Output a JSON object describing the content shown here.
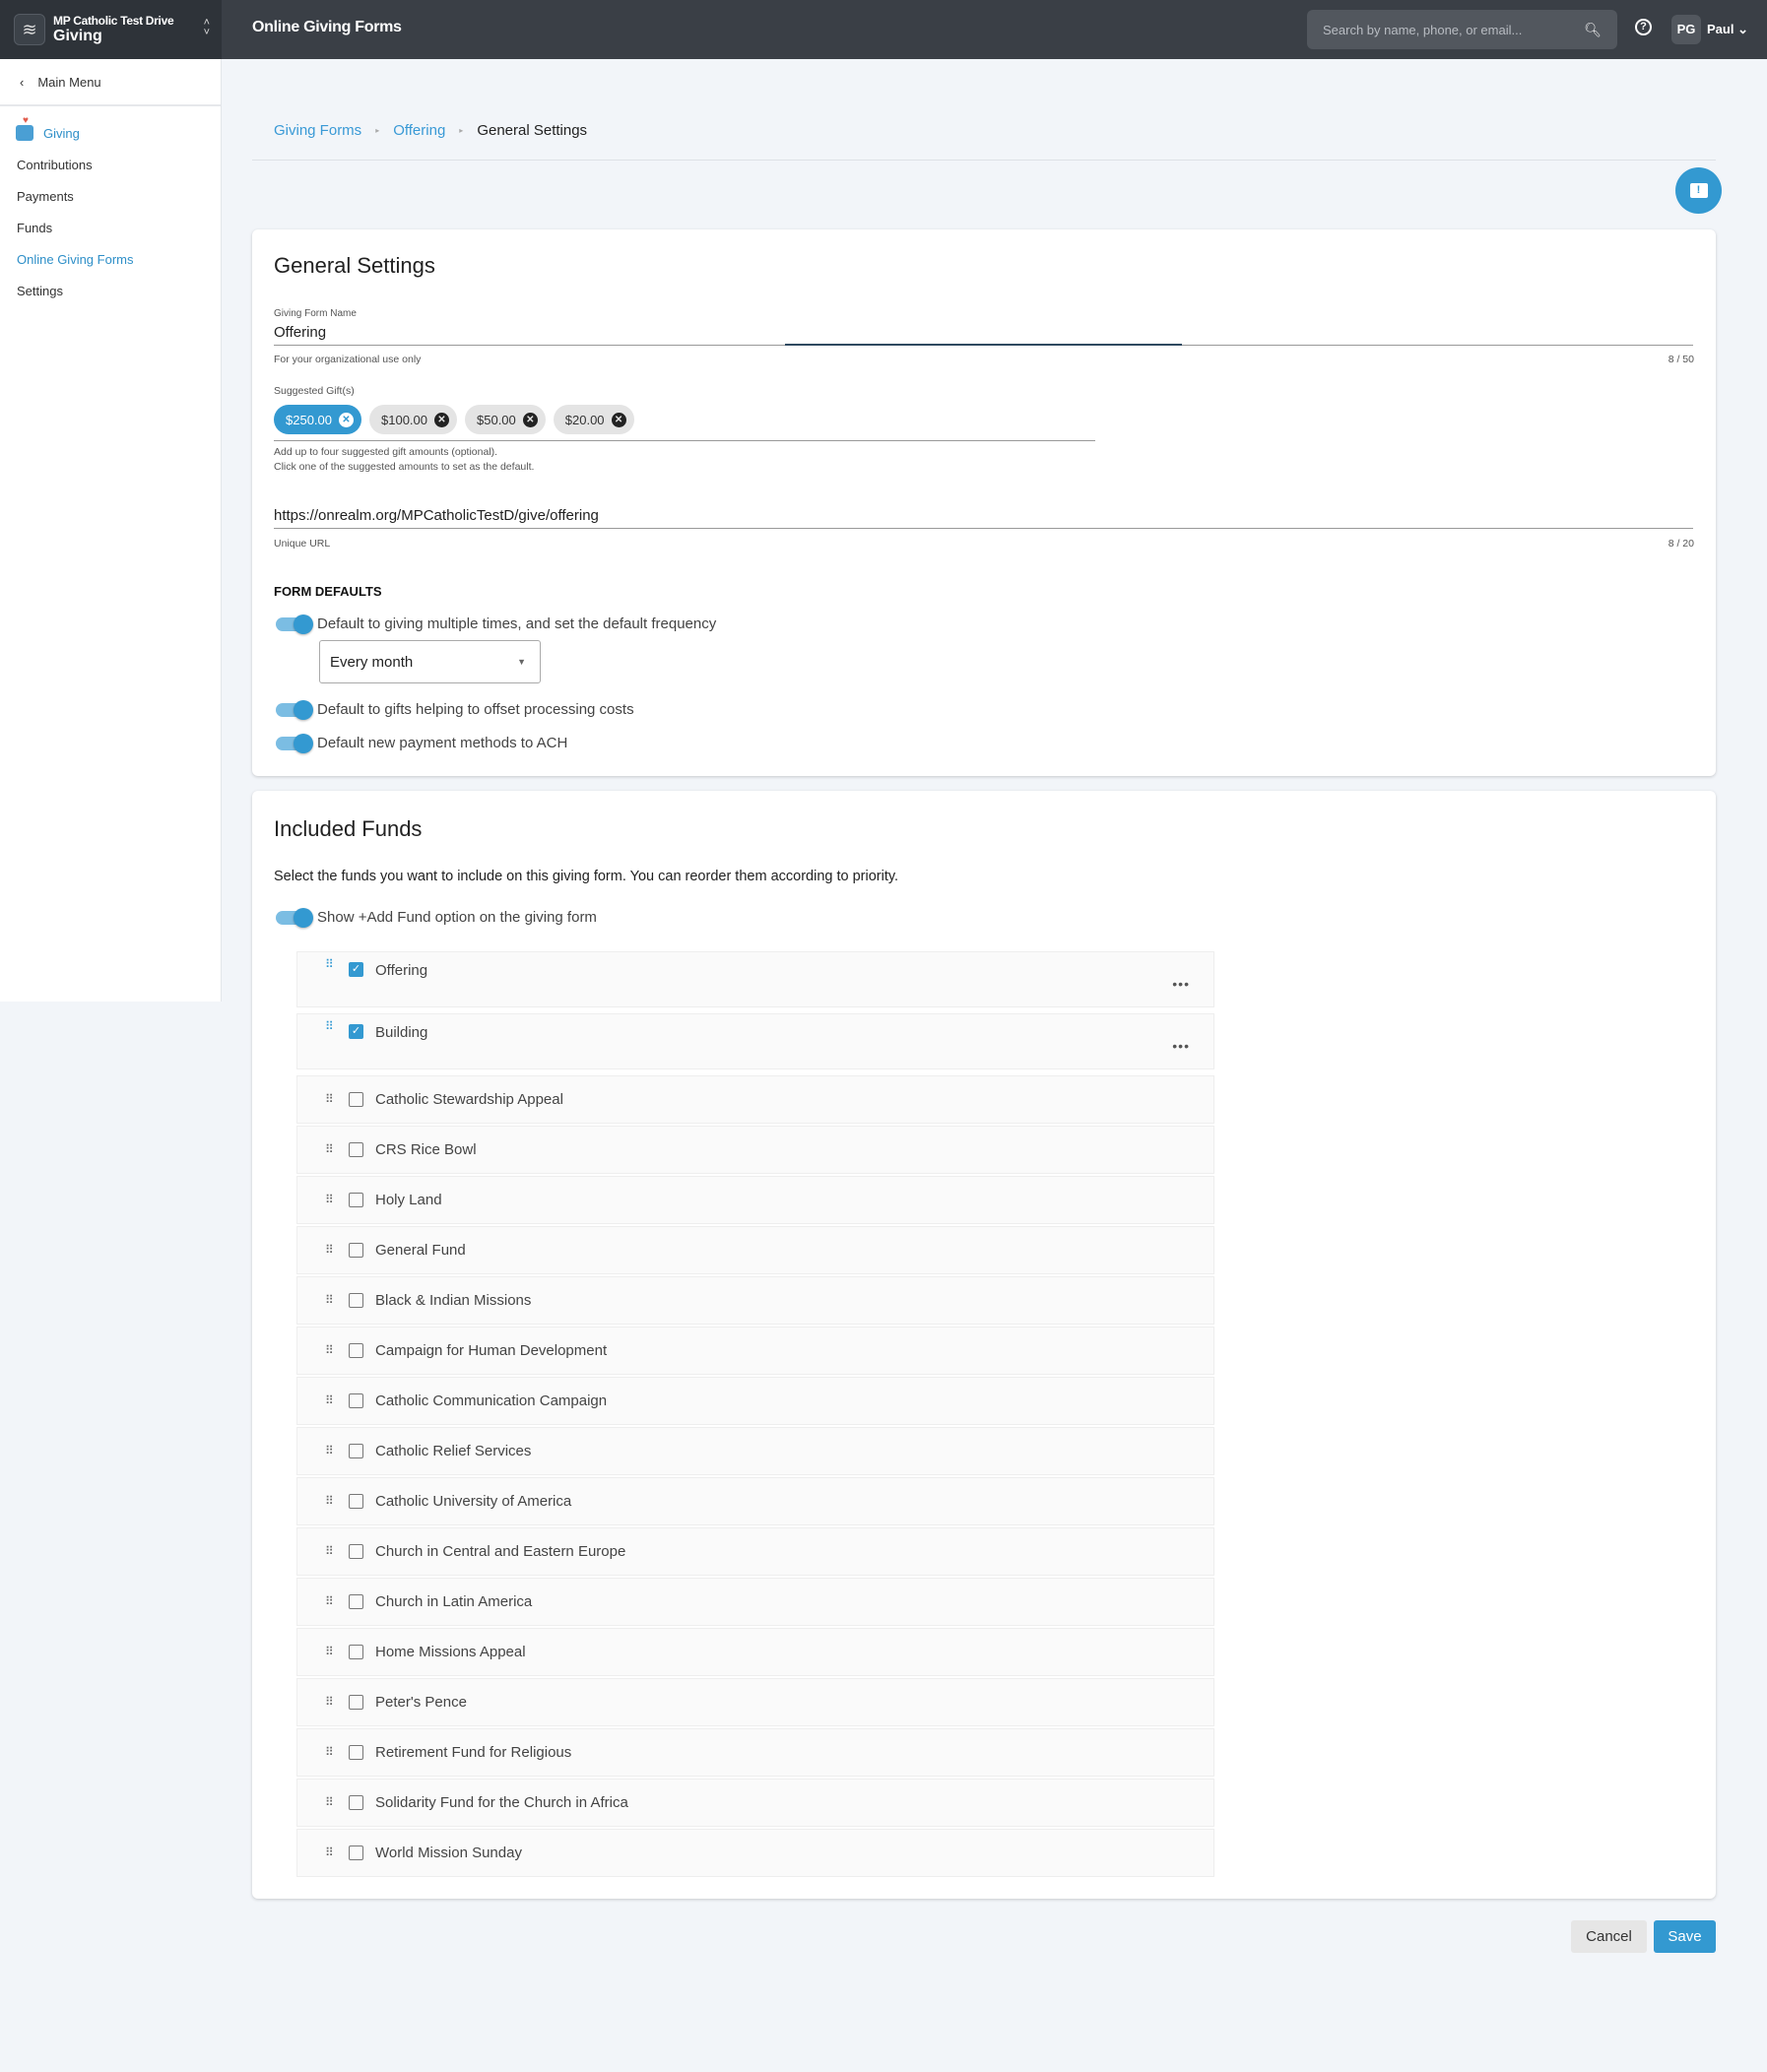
{
  "brand": {
    "org": "MP Catholic Test Drive",
    "app": "Giving"
  },
  "header": {
    "title": "Online Giving Forms",
    "search_placeholder": "Search by name, phone, or email...",
    "avatar": "PG",
    "user": "Paul"
  },
  "sidebar": {
    "main_menu": "Main Menu",
    "section": "Giving",
    "items": [
      {
        "label": "Contributions"
      },
      {
        "label": "Payments"
      },
      {
        "label": "Funds"
      },
      {
        "label": "Online Giving Forms",
        "active": true
      },
      {
        "label": "Settings"
      }
    ]
  },
  "breadcrumb": [
    "Giving Forms",
    "Offering",
    "General Settings"
  ],
  "general": {
    "title": "General Settings",
    "name_label": "Giving Form Name",
    "name_value": "Offering",
    "name_helper": "For your organizational use only",
    "name_count": "8 / 50",
    "gifts_label": "Suggested Gift(s)",
    "gifts": [
      {
        "amount": "$250.00",
        "selected": true
      },
      {
        "amount": "$100.00"
      },
      {
        "amount": "$50.00"
      },
      {
        "amount": "$20.00"
      }
    ],
    "gifts_help1": "Add up to four suggested gift amounts (optional).",
    "gifts_help2": "Click one of the suggested amounts to set as the default.",
    "url_value": "https://onrealm.org/MPCatholicTestD/give/offering",
    "url_label": "Unique URL",
    "url_count": "8 / 20",
    "defaults_title": "FORM DEFAULTS",
    "toggle1": "Default to giving multiple times, and set the default frequency",
    "frequency": "Every month",
    "toggle2": "Default to gifts helping to offset processing costs",
    "toggle3": "Default new payment methods to ACH"
  },
  "funds": {
    "title": "Included Funds",
    "description": "Select the funds you want to include on this giving form. You can reorder them according to priority.",
    "toggle": "Show +Add Fund option on the giving form",
    "items": [
      {
        "name": "Offering",
        "checked": true
      },
      {
        "name": "Building",
        "checked": true
      },
      {
        "name": "Catholic Stewardship Appeal"
      },
      {
        "name": "CRS Rice Bowl"
      },
      {
        "name": "Holy Land"
      },
      {
        "name": "General Fund"
      },
      {
        "name": "Black & Indian Missions"
      },
      {
        "name": "Campaign for Human Development"
      },
      {
        "name": "Catholic Communication Campaign"
      },
      {
        "name": "Catholic Relief Services"
      },
      {
        "name": "Catholic University of America"
      },
      {
        "name": "Church in Central and Eastern Europe"
      },
      {
        "name": "Church in Latin America"
      },
      {
        "name": "Home Missions Appeal"
      },
      {
        "name": "Peter's Pence"
      },
      {
        "name": "Retirement Fund for Religious"
      },
      {
        "name": "Solidarity Fund for the Church in Africa"
      },
      {
        "name": "World Mission Sunday"
      }
    ]
  },
  "actions": {
    "cancel": "Cancel",
    "save": "Save"
  },
  "colors": {
    "accent": "#3399d1",
    "header": "#3a3f46"
  }
}
